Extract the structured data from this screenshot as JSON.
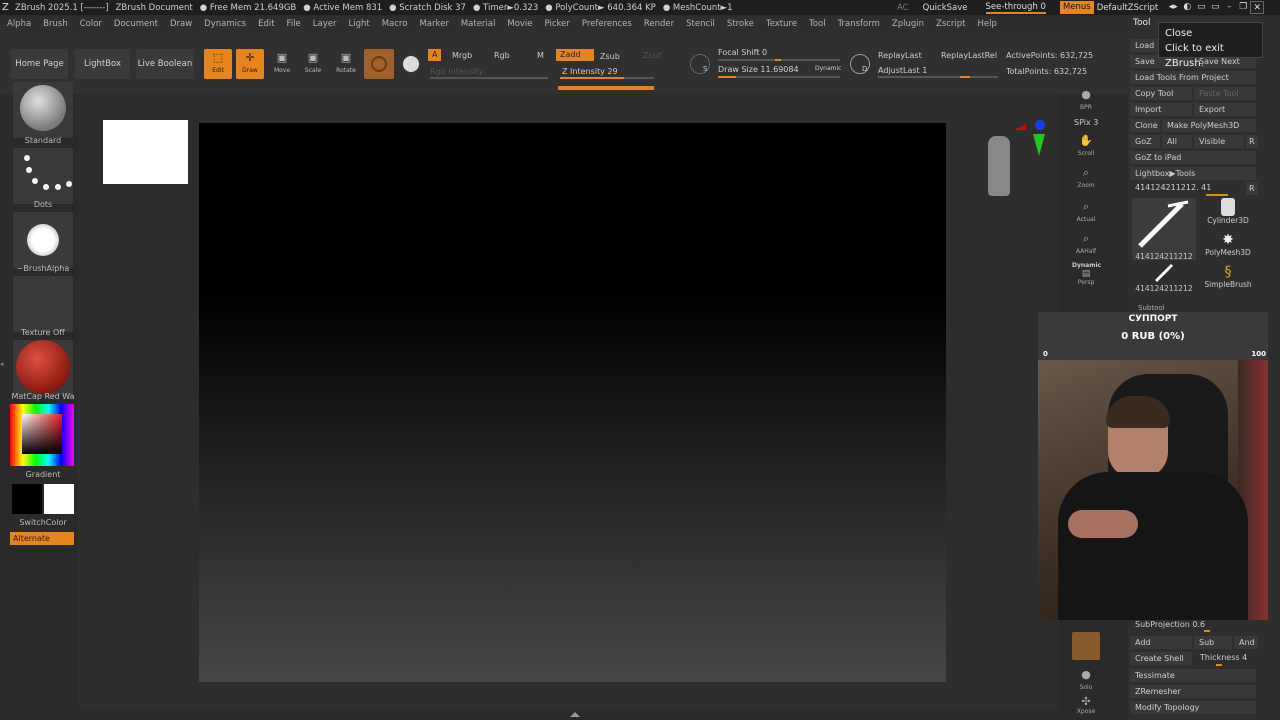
{
  "titlebar": {
    "app": "ZBrush 2025.1 [-------]",
    "document": "ZBrush Document",
    "free_mem": "● Free Mem 21.649GB",
    "active_mem": "● Active Mem 831",
    "scratch": "● Scratch Disk 37",
    "timer": "● Timer►0.323",
    "polycount": "● PolyCount► 640.364 KP",
    "meshcount": "● MeshCount►1",
    "ac": "AC",
    "quicksave": "QuickSave",
    "see_through": "See-through  0",
    "menus": "Menus",
    "defaultzscript": "DefaultZScript"
  },
  "menubar": [
    "Alpha",
    "Brush",
    "Color",
    "Document",
    "Draw",
    "Dynamics",
    "Edit",
    "File",
    "Layer",
    "Light",
    "Macro",
    "Marker",
    "Material",
    "Movie",
    "Picker",
    "Preferences",
    "Render",
    "Stencil",
    "Stroke",
    "Texture",
    "Tool",
    "Transform",
    "Zplugin",
    "Zscript",
    "Help"
  ],
  "shelf": {
    "home_page": "Home Page",
    "lightbox": "LightBox",
    "live_boolean": "Live Boolean",
    "edit": "Edit",
    "draw": "Draw",
    "move": "Move",
    "scale": "Scale",
    "rotate": "Rotate",
    "a": "A",
    "mrgb": "Mrgb",
    "rgb": "Rgb",
    "m": "M",
    "zadd": "Zadd",
    "zsub": "Zsub",
    "zcut": "Zcut",
    "rgb_intensity": "Rgb Intensity",
    "z_intensity": "Z Intensity 29",
    "focal_shift": "Focal Shift 0",
    "draw_size": "Draw Size 11.69084",
    "dynamic": "Dynamic",
    "replay_last": "ReplayLast",
    "replay_last_rel": "ReplayLastRel",
    "adjust_last": "AdjustLast 1",
    "active_points": "ActivePoints: 632,725",
    "total_points": "TotalPoints: 632,725",
    "s_letter": "S",
    "d_letter": "D"
  },
  "left_panel": {
    "brush": "Standard",
    "stroke": "Dots",
    "alpha": "~BrushAlpha",
    "texture": "Texture Off",
    "material": "MatCap Red Wa",
    "gradient": "Gradient",
    "switch_color": "SwitchColor",
    "alternate": "Alternate"
  },
  "nav": {
    "bpr": "BPR",
    "spix": "SPix 3",
    "scroll": "Scroll",
    "zoom": "Zoom",
    "actual": "Actual",
    "aahalf": "AAHalf",
    "dynamic": "Dynamic",
    "persp": "Persp",
    "solo": "Solo",
    "xpose": "Xpose"
  },
  "tool_palette": {
    "title": "Tool",
    "load": "Load T",
    "save": "Save",
    "save_next": "Save Next",
    "load_tools_from_project": "Load Tools From Project",
    "copy_tool": "Copy Tool",
    "paste_tool": "Paste Tool",
    "import": "Import",
    "export": "Export",
    "clone": "Clone",
    "make_polymesh": "Make PolyMesh3D",
    "goz": "GoZ",
    "all": "All",
    "visible": "Visible",
    "r": "R",
    "goz_ipad": "GoZ to iPad",
    "lightbox_tools": "Lightbox▶Tools",
    "tool_name": "414124211212. 41",
    "thumb1": "414124211212",
    "thumb2": "Cylinder3D",
    "thumb3": "PolyMesh3D",
    "thumb4": "414124211212",
    "thumb5": "SimpleBrush",
    "subtool": "Subtool",
    "subprojection": "SubProjection 0.6",
    "add": "Add",
    "sub": "Sub",
    "and": "And",
    "create_shell": "Create Shell",
    "thickness": "Thickness 4",
    "tessimate": "Tessimate",
    "zremesher": "ZRemesher",
    "modify_topology": "Modify Topology"
  },
  "tooltip": {
    "line1": "Close",
    "line2": "Click to exit ZBrush."
  },
  "donation": {
    "title": "СУППОРТ",
    "amount": "0 RUB (0%)",
    "min": "0",
    "max": "100"
  },
  "colors": {
    "accent": "#e8841c",
    "panel": "#2e2e2e",
    "canvas_top": "#000000"
  }
}
